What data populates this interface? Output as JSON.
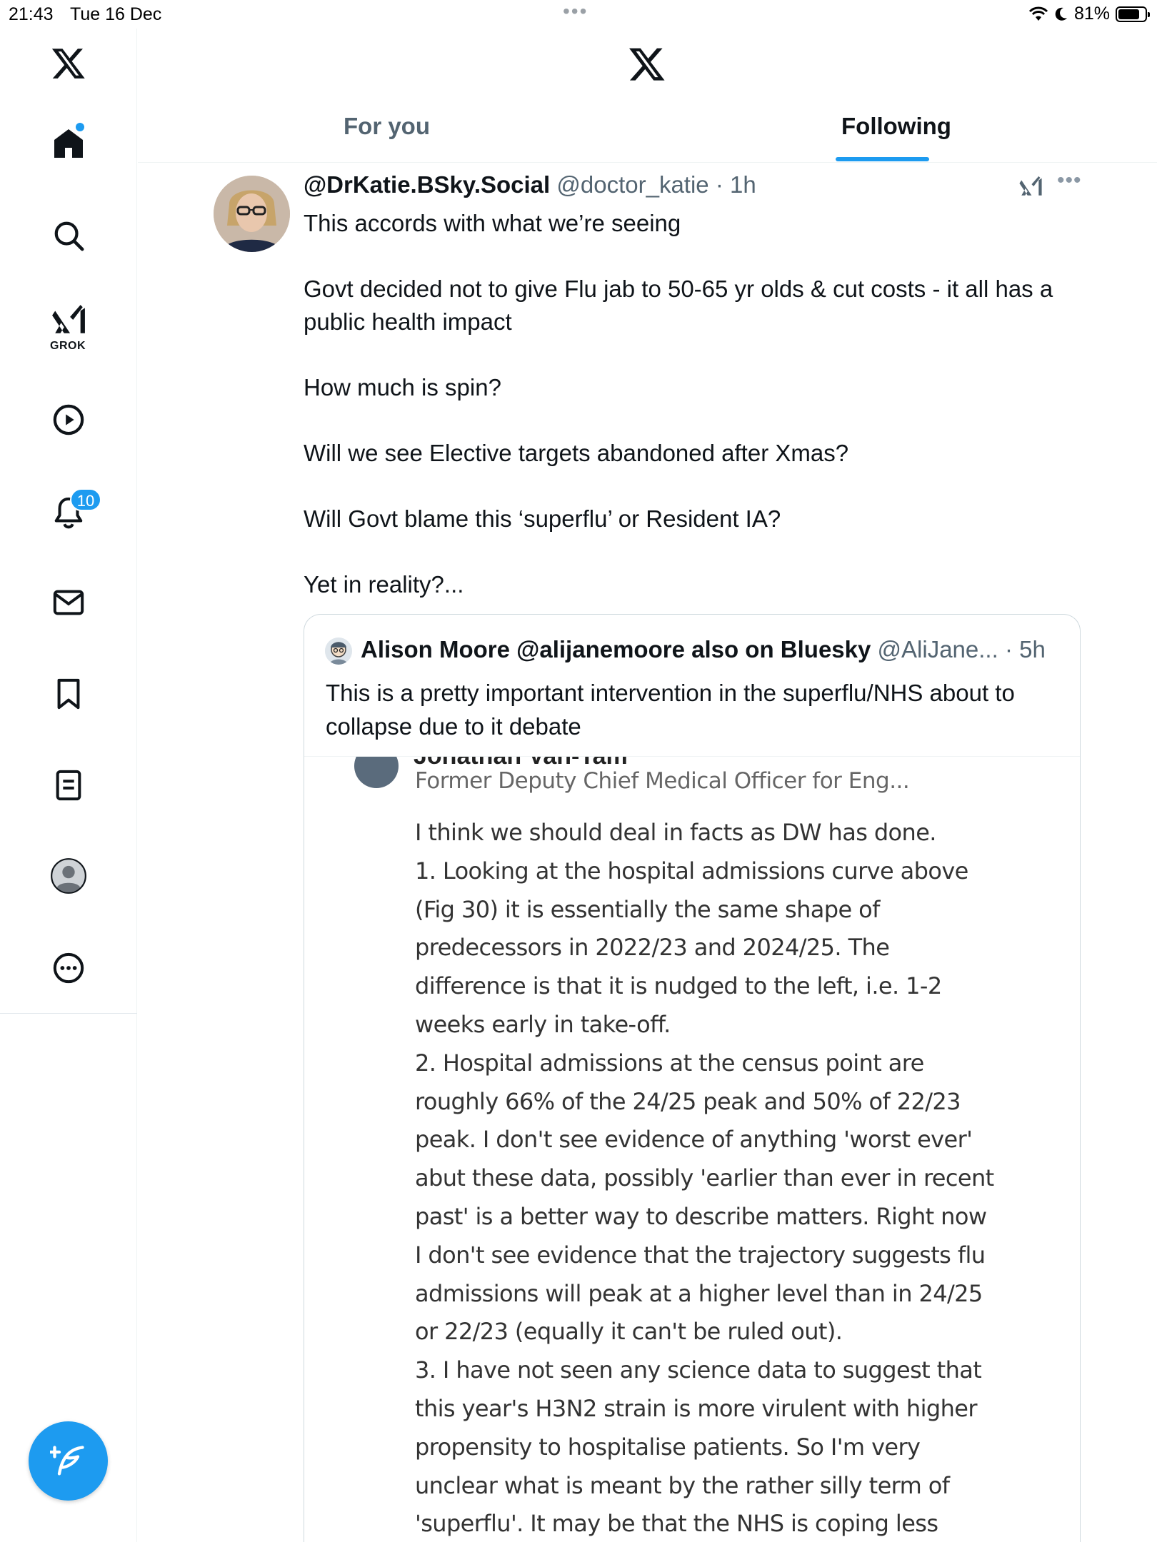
{
  "status_bar": {
    "time": "21:43",
    "date": "Tue 16 Dec",
    "battery": "81%",
    "battery_level": 0.81
  },
  "sidebar": {
    "items": [
      {
        "icon": "x-logo-icon"
      },
      {
        "icon": "home-icon"
      },
      {
        "icon": "search-icon"
      },
      {
        "icon": "grok-icon",
        "label": "GROK"
      },
      {
        "icon": "play-icon"
      },
      {
        "icon": "bell-icon",
        "badge": "10"
      },
      {
        "icon": "mail-icon"
      },
      {
        "icon": "bookmark-icon"
      },
      {
        "icon": "list-icon"
      },
      {
        "icon": "profile-icon"
      },
      {
        "icon": "more-icon"
      }
    ],
    "compose_icon": "compose-icon"
  },
  "header": {
    "tabs": [
      {
        "label": "For you",
        "active": false
      },
      {
        "label": "Following",
        "active": true
      }
    ],
    "accent": "#1d9bf0"
  },
  "tweet": {
    "display_name": "@DrKatie.BSky.Social",
    "handle": "@doctor_katie",
    "time": "1h",
    "lines": [
      "This accords with what we’re seeing",
      "Govt decided not to give Flu jab to  50-65 yr olds & cut costs - it all has a public health impact",
      "How much is spin?",
      "Will we see Elective targets abandoned after Xmas?",
      "Will Govt blame this ‘superflu’ or Resident IA?",
      "Yet in reality?..."
    ]
  },
  "quote": {
    "display_name": "Alison Moore @alijanemoore also on Bluesky",
    "handle": "@AliJane...",
    "time": "5h",
    "text": "This is a pretty important intervention in the superflu/NHS about to collapse due to it debate",
    "image": {
      "author_name": "Jonathan Van-Tam",
      "author_sub": "Former Deputy Chief Medical Officer for Eng...",
      "lines": [
        "I think we should deal in facts as DW has done.",
        "1. Looking at the hospital admissions curve above",
        "(Fig 30) it is essentially the same shape of",
        "predecessors in 2022/23 and 2024/25. The",
        "difference is that it is nudged to the left, i.e. 1-2",
        "weeks early in take-off.",
        "2. Hospital admissions at the census point are",
        "roughly 66% of the 24/25 peak and 50% of 22/23",
        "peak. I don't see evidence of anything 'worst ever'",
        "abut these data, possibly 'earlier than ever in recent",
        "past' is a better way to describe matters. Right now",
        "I don't see evidence that the trajectory suggests flu",
        "admissions will peak at a higher level than in 24/25",
        "or 22/23 (equally it can't be ruled out).",
        "3. I have not seen any science data to suggest that",
        "this year's H3N2 strain is more virulent with higher",
        "propensity to hospitalise patients. So I'm very",
        "unclear what is meant by the rather silly term of",
        "'superflu'. It may be that the NHS is coping less"
      ]
    }
  }
}
